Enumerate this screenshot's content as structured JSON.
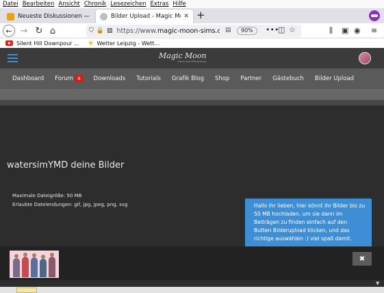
{
  "menu": [
    "Datei",
    "Bearbeiten",
    "Ansicht",
    "Chronik",
    "Lesezeichen",
    "Extras",
    "Hilfe"
  ],
  "tabs": [
    {
      "title": "Neueste Diskussionen — The Si",
      "favicon_color": "#e8a21a",
      "active": false
    },
    {
      "title": "Bilder Upload - Magic Moon",
      "favicon_color": "#bfbfbf",
      "active": true
    }
  ],
  "new_tab_label": "+",
  "navbar": {
    "url_protocol": "https://www.",
    "url_host": "magic-moon-sims.co",
    "zoom": "90%",
    "more": "•••"
  },
  "bookmarks": [
    {
      "label": "Silent Hill Downpour ...",
      "icon": "youtube-icon"
    },
    {
      "label": "Wetter Leipzig - Wett...",
      "icon": "sun-icon"
    }
  ],
  "site": {
    "logo_text": "Magic Moon",
    "logo_sub": "Sims and Photoshop",
    "nav": [
      {
        "label": "Dashboard"
      },
      {
        "label": "Forum",
        "badge": "4"
      },
      {
        "label": "Downloads"
      },
      {
        "label": "Tutorials"
      },
      {
        "label": "Grafik Blog"
      },
      {
        "label": "Shop"
      },
      {
        "label": "Partner"
      },
      {
        "label": "Gästebuch"
      },
      {
        "label": "Bilder Upload"
      }
    ],
    "page_title": "watersimYMD deine Bilder",
    "max_size": "Maximale Dateigröße: 50 MB",
    "allowed_ext": "Erlaubte Dateiendungen: gif, jpg, jpeg, png, svg",
    "tooltip": "Hallo ihr lieben, hier könnt ihr Bilder bis zu 50 MB hochladen. um sie dann im Beiträgen zu finden einfach auf den Butten Bilderupload klicken, und das richtige auswählen :) viel spaß damit.",
    "close_symbol": "✖",
    "scroll_down": "▼"
  },
  "colors": {
    "accent_blue": "#3d8ed4",
    "badge_red": "#e01818",
    "site_bg": "#2d2d2d"
  }
}
